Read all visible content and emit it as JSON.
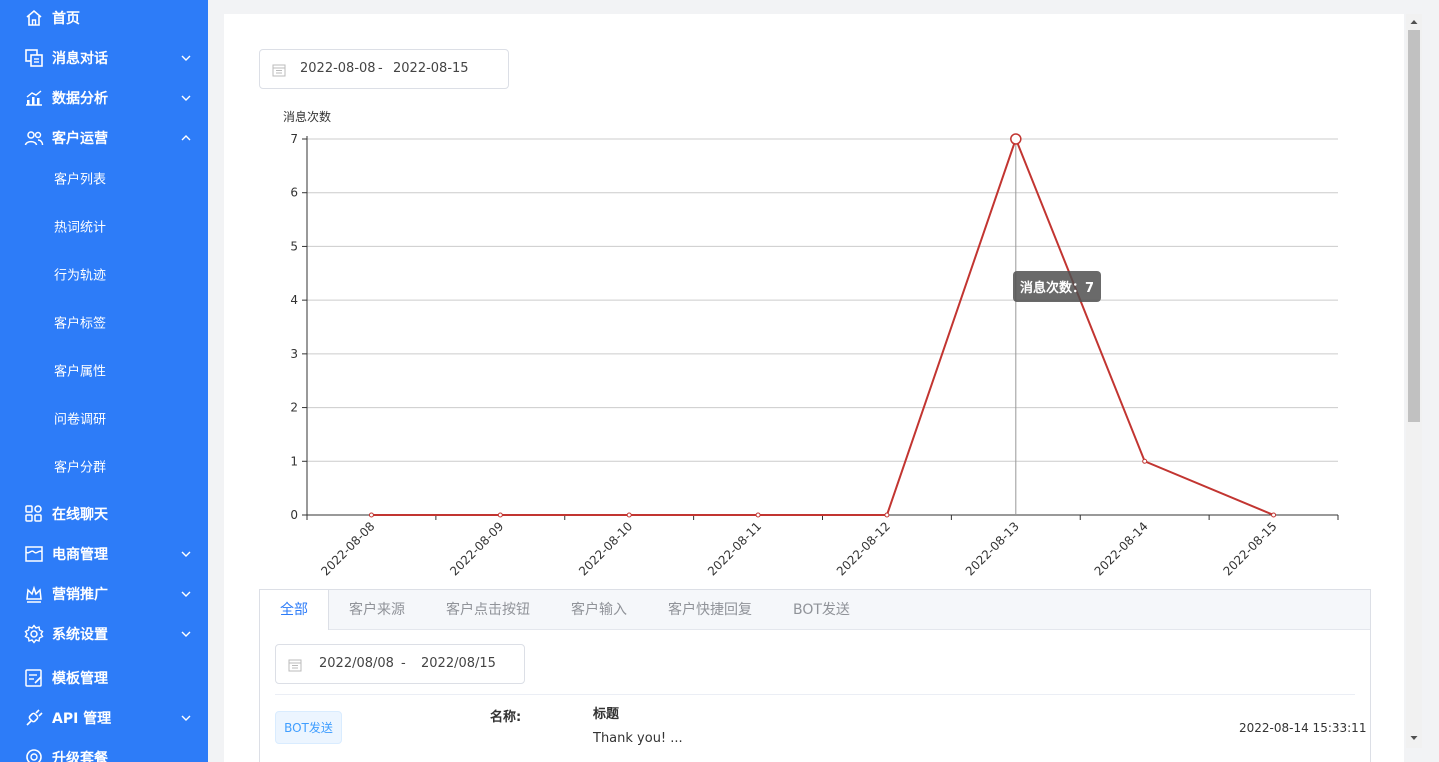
{
  "sidebar": {
    "items": [
      {
        "label": "首页",
        "icon": "home-icon",
        "expandable": false
      },
      {
        "label": "消息对话",
        "icon": "message-icon",
        "expandable": true,
        "expanded": false
      },
      {
        "label": "数据分析",
        "icon": "analytics-icon",
        "expandable": true,
        "expanded": false
      },
      {
        "label": "客户运营",
        "icon": "users-icon",
        "expandable": true,
        "expanded": true
      },
      {
        "label": "在线聊天",
        "icon": "apps-icon",
        "expandable": false
      },
      {
        "label": "电商管理",
        "icon": "shop-icon",
        "expandable": true,
        "expanded": false
      },
      {
        "label": "营销推广",
        "icon": "crown-icon",
        "expandable": true,
        "expanded": false
      },
      {
        "label": "系统设置",
        "icon": "gear-icon",
        "expandable": true,
        "expanded": false
      },
      {
        "label": "模板管理",
        "icon": "template-icon",
        "expandable": false
      },
      {
        "label": "API 管理",
        "icon": "plug-icon",
        "expandable": true,
        "expanded": false
      },
      {
        "label": "升级套餐",
        "icon": "upgrade-icon",
        "expandable": false
      }
    ],
    "subitems": [
      "客户列表",
      "热词统计",
      "行为轨迹",
      "客户标签",
      "客户属性",
      "问卷调研",
      "客户分群"
    ]
  },
  "top_range": {
    "start": "2022-08-08",
    "sep": "-",
    "end": "2022-08-15"
  },
  "chart_data": {
    "type": "line",
    "ylabel": "消息次数",
    "categories": [
      "2022-08-08",
      "2022-08-09",
      "2022-08-10",
      "2022-08-11",
      "2022-08-12",
      "2022-08-13",
      "2022-08-14",
      "2022-08-15"
    ],
    "series": [
      {
        "name": "消息次数",
        "values": [
          0,
          0,
          0,
          0,
          0,
          7,
          1,
          0
        ]
      }
    ],
    "yticks": [
      0,
      1,
      2,
      3,
      4,
      5,
      6,
      7
    ],
    "ylim": [
      0,
      7
    ],
    "grid": true,
    "color": "#c23531",
    "highlight_index": 5
  },
  "tooltip": {
    "text": "消息次数：7"
  },
  "tabs": [
    {
      "label": "全部",
      "active": true
    },
    {
      "label": "客户来源",
      "active": false
    },
    {
      "label": "客户点击按钮",
      "active": false
    },
    {
      "label": "客户输入",
      "active": false
    },
    {
      "label": "客户快捷回复",
      "active": false
    },
    {
      "label": "BOT发送",
      "active": false
    }
  ],
  "list_range": {
    "start": "2022/08/08",
    "sep": "-",
    "end": "2022/08/15"
  },
  "record": {
    "type": "BOT发送",
    "name_label": "名称:",
    "title_label": "标题",
    "message": "Thank you! ...",
    "time": "2022-08-14 15:33:11"
  },
  "colors": {
    "sidebar": "#2d7cf8",
    "accent": "#409eff",
    "line": "#c23531"
  }
}
